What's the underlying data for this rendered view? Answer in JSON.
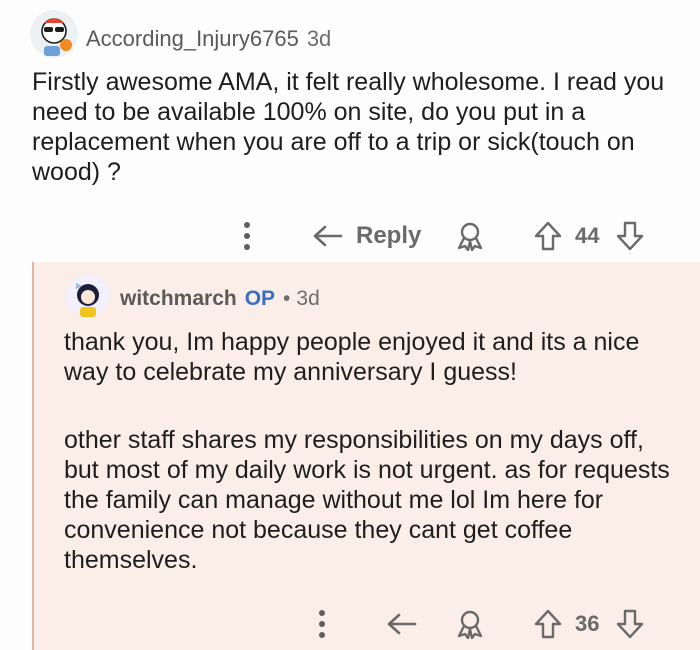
{
  "comments": [
    {
      "username": "According_Injury6765",
      "time": "3d",
      "body": "Firstly awesome AMA, it felt really wholesome. I read you need to be available 100% on site, do you put in a replacement when you are off to a trip or sick(touch on wood) ?",
      "reply_label": "Reply",
      "score": "44"
    },
    {
      "username": "witchmarch",
      "op_badge": "OP",
      "separator": "•",
      "time": "3d",
      "paragraphs": [
        "thank you, Im happy people enjoyed it and its a nice way to celebrate my anniversary I guess!",
        "other staff shares my responsibilities on my days off, but most of my daily work is not urgent. as for requests the family can manage without me lol Im here for convenience not because they cant get coffee themselves."
      ],
      "score": "36"
    }
  ],
  "icons": {
    "more": "more-vertical-icon",
    "reply": "reply-arrow-icon",
    "award": "award-icon",
    "upvote": "upvote-arrow-icon",
    "downvote": "downvote-arrow-icon"
  },
  "colors": {
    "op_badge": "#3b6fc4",
    "thread_background": "#fbeee8",
    "thread_line": "#e0b4a6",
    "action_gray": "#6a6a6a"
  }
}
